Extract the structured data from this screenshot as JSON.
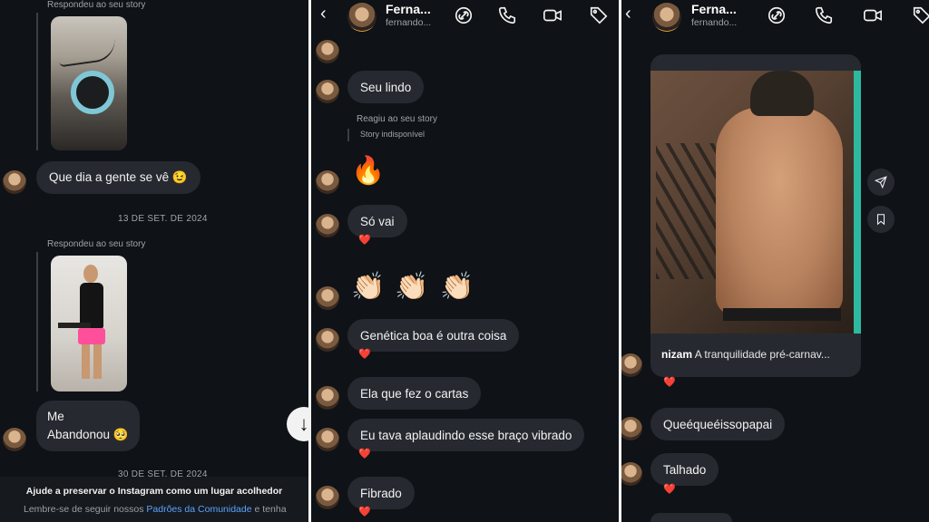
{
  "panel1": {
    "story_replies": [
      {
        "label": "Respondeu ao seu story"
      },
      {
        "label": "Respondeu ao seu story"
      }
    ],
    "messages": [
      {
        "text": "Que dia a gente se vê 😉"
      },
      {
        "text": "Me\nAbandonou 🥺"
      }
    ],
    "dates": [
      "13 DE SET. DE 2024",
      "30 DE SET. DE 2024"
    ],
    "notice": {
      "title": "Ajude a preservar o Instagram como um lugar acolhedor",
      "text_before": "Lembre-se de seguir nossos ",
      "link": "Padrões da Comunidade",
      "text_after": " e tenha"
    },
    "scroll_icon": "arrow-down-icon"
  },
  "panel2": {
    "header": {
      "name": "Ferna...",
      "username": "fernando..."
    },
    "top_emojis": [
      "🔻",
      "👏",
      "🍀"
    ],
    "messages": [
      {
        "text": "Seu lindo"
      },
      {
        "text": "Só vai"
      },
      {
        "text": "Genética boa é outra coisa"
      },
      {
        "text": "Ela que fez o cartas"
      },
      {
        "text": "Eu tava aplaudindo esse braço vibrado"
      },
      {
        "text": "Fibrado"
      }
    ],
    "reacted_label": "Reagiu ao seu story",
    "story_unavailable": "Story indisponível",
    "fire_emoji": "🔥",
    "clap_emojis": [
      "👏🏻",
      "👏🏻",
      "👏🏻"
    ],
    "heart": "❤️",
    "icons": [
      "link-icon",
      "phone-icon",
      "video-icon",
      "tag-icon"
    ]
  },
  "panel3": {
    "header": {
      "name": "Ferna...",
      "username": "fernando..."
    },
    "post": {
      "author": "nizam",
      "caption": "A tranquilidade pré-carnav..."
    },
    "messages": [
      {
        "text": "Queéqueéissopapai"
      },
      {
        "text": "Talhado"
      }
    ],
    "heart": "❤️",
    "side_icons": [
      "send-icon",
      "bookmark-icon"
    ]
  },
  "colors": {
    "background": "#0f1216",
    "bubble": "#262a30",
    "heart": "#e0243d",
    "link": "#5aa4ff"
  }
}
